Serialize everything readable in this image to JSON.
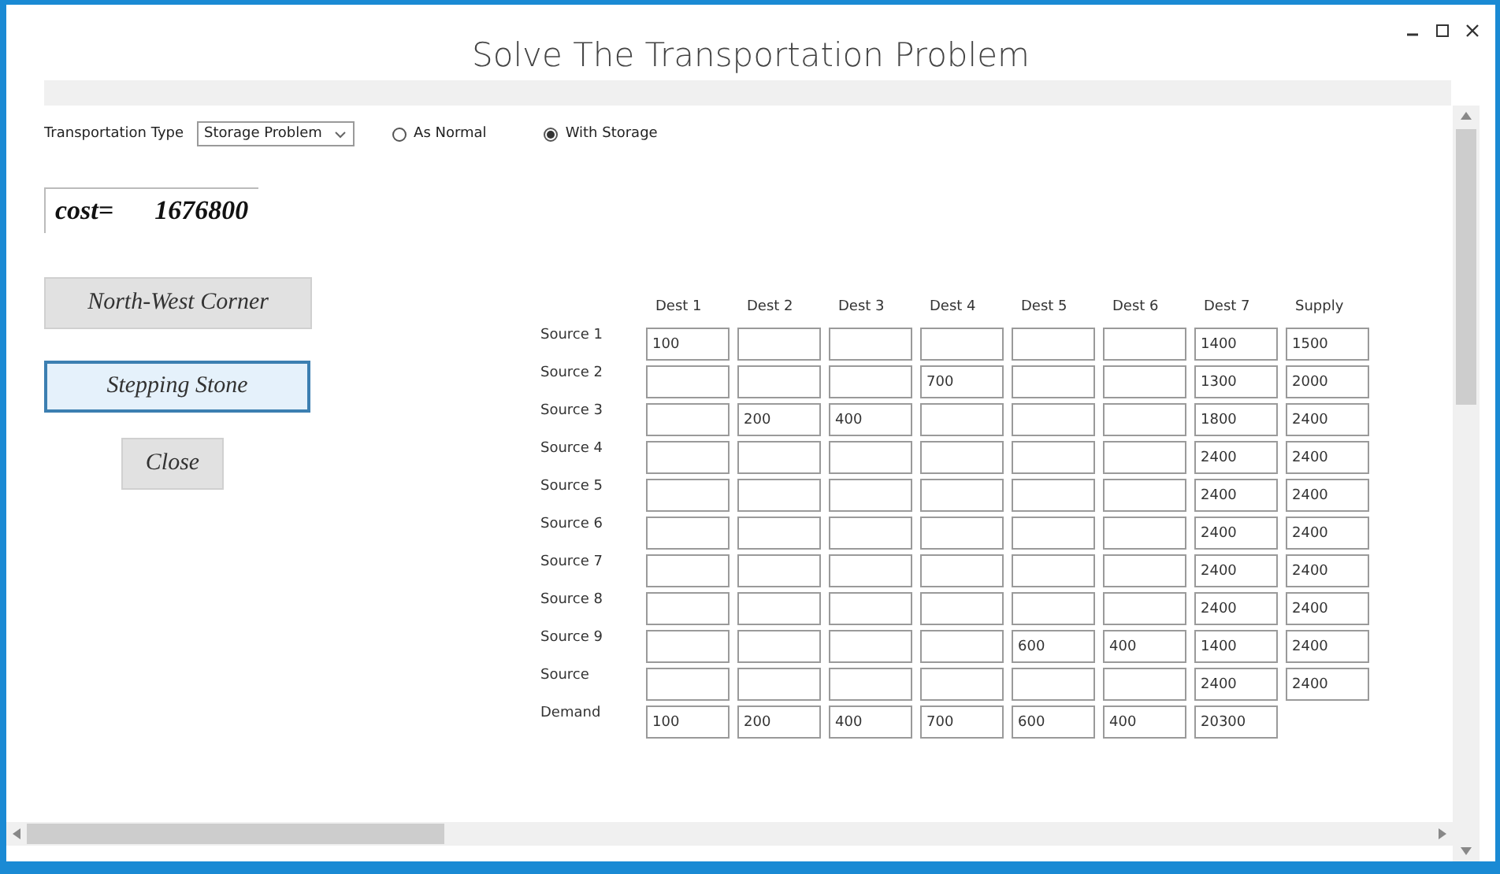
{
  "window": {
    "title": "Solve The Transportation  Problem"
  },
  "toolbar": {
    "type_label": "Transportation Type",
    "type_value": "Storage Problem",
    "options": [
      {
        "label": "As Normal",
        "selected": false
      },
      {
        "label": "With Storage",
        "selected": true
      }
    ]
  },
  "cost": {
    "label": "cost=",
    "value": "1676800"
  },
  "buttons": [
    {
      "label": "North-West Corner",
      "focused": false
    },
    {
      "label": "Stepping Stone",
      "focused": true
    },
    {
      "label": "Close",
      "focused": false
    }
  ],
  "table": {
    "columns": [
      "Dest 1",
      "Dest 2",
      "Dest 3",
      "Dest 4",
      "Dest 5",
      "Dest 6",
      "Dest 7",
      "Supply"
    ],
    "rows": [
      {
        "label": "Source 1",
        "cells": [
          "100",
          null,
          null,
          null,
          null,
          null,
          "1400",
          "1500"
        ]
      },
      {
        "label": "Source 2",
        "cells": [
          null,
          null,
          null,
          "700",
          null,
          null,
          "1300",
          "2000"
        ]
      },
      {
        "label": "Source 3",
        "cells": [
          null,
          "200",
          "400",
          null,
          null,
          null,
          "1800",
          "2400"
        ]
      },
      {
        "label": "Source 4",
        "cells": [
          null,
          null,
          null,
          null,
          null,
          null,
          "2400",
          "2400"
        ]
      },
      {
        "label": "Source 5",
        "cells": [
          null,
          null,
          null,
          null,
          null,
          null,
          "2400",
          "2400"
        ]
      },
      {
        "label": "Source 6",
        "cells": [
          null,
          null,
          null,
          null,
          null,
          null,
          "2400",
          "2400"
        ]
      },
      {
        "label": "Source 7",
        "cells": [
          null,
          null,
          null,
          null,
          null,
          null,
          "2400",
          "2400"
        ]
      },
      {
        "label": "Source 8",
        "cells": [
          null,
          null,
          null,
          null,
          null,
          null,
          "2400",
          "2400"
        ]
      },
      {
        "label": "Source 9",
        "cells": [
          null,
          null,
          null,
          null,
          "600",
          "400",
          "1400",
          "2400"
        ]
      },
      {
        "label": "Source",
        "cells": [
          null,
          null,
          null,
          null,
          null,
          null,
          "2400",
          "2400"
        ]
      },
      {
        "label": "Demand",
        "cells": [
          "100",
          "200",
          "400",
          "700",
          "600",
          "400",
          "20300"
        ]
      }
    ]
  }
}
